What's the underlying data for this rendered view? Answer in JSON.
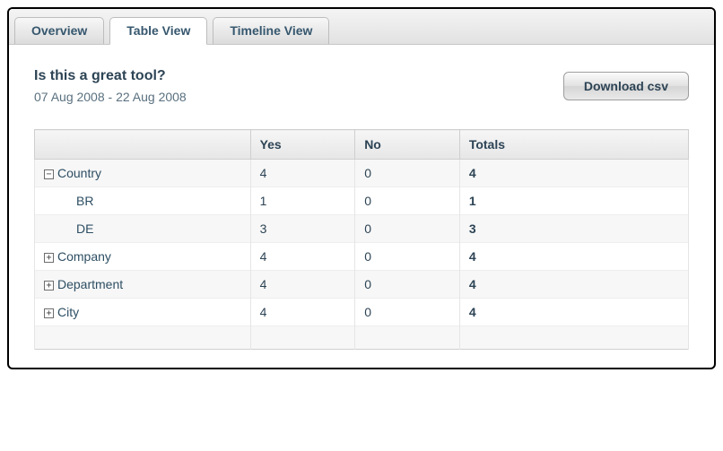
{
  "tabs": [
    {
      "label": "Overview",
      "active": false
    },
    {
      "label": "Table View",
      "active": true
    },
    {
      "label": "Timeline View",
      "active": false
    }
  ],
  "question": "Is this a great tool?",
  "date_range": "07 Aug 2008 - 22 Aug 2008",
  "download_label": "Download csv",
  "columns": {
    "c0": "",
    "c1": "Yes",
    "c2": "No",
    "c3": "Totals"
  },
  "toggles": {
    "minus": "−",
    "plus": "+"
  },
  "rows": {
    "country": {
      "label": "Country",
      "yes": "4",
      "no": "0",
      "total": "4",
      "expanded": true
    },
    "country_br": {
      "label": "BR",
      "yes": "1",
      "no": "0",
      "total": "1"
    },
    "country_de": {
      "label": "DE",
      "yes": "3",
      "no": "0",
      "total": "3"
    },
    "company": {
      "label": "Company",
      "yes": "4",
      "no": "0",
      "total": "4",
      "expanded": false
    },
    "department": {
      "label": "Department",
      "yes": "4",
      "no": "0",
      "total": "4",
      "expanded": false
    },
    "city": {
      "label": "City",
      "yes": "4",
      "no": "0",
      "total": "4",
      "expanded": false
    }
  }
}
